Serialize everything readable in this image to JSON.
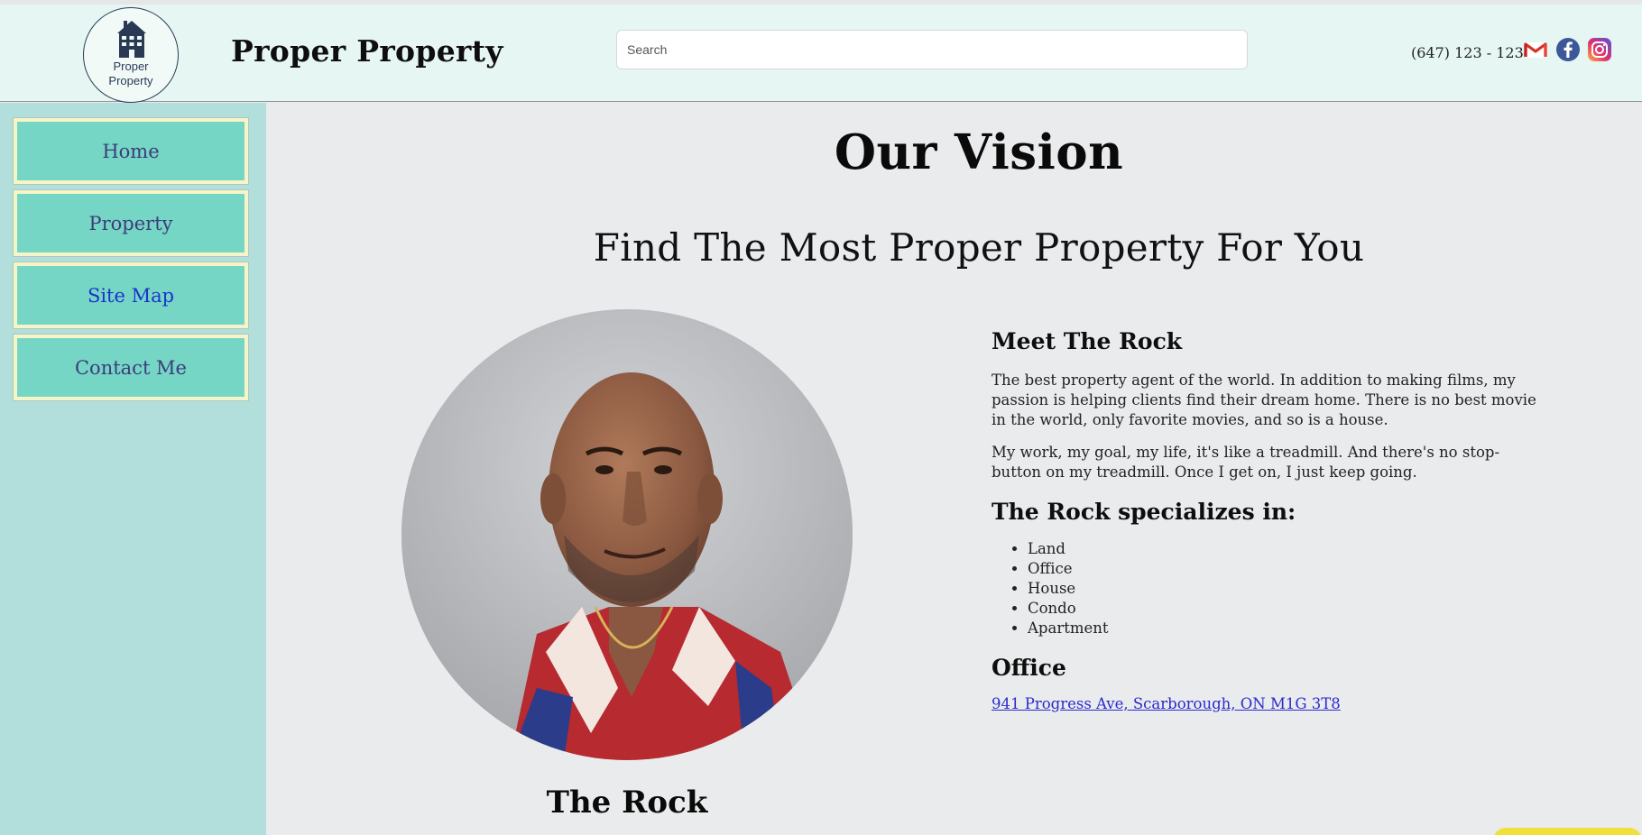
{
  "header": {
    "logo_line1": "Proper",
    "logo_line2": "Property",
    "brand": "Proper Property",
    "search_placeholder": "Search",
    "phone": "(647) 123 - 1234",
    "social": [
      {
        "name": "gmail-icon",
        "color": "#d93025"
      },
      {
        "name": "facebook-icon",
        "color": "#3b5998"
      },
      {
        "name": "instagram-icon",
        "color": "#c13584"
      }
    ]
  },
  "sidebar": {
    "items": [
      {
        "label": "Home",
        "active": false
      },
      {
        "label": "Property",
        "active": false
      },
      {
        "label": "Site Map",
        "active": true
      },
      {
        "label": "Contact Me",
        "active": false
      }
    ]
  },
  "main": {
    "title": "Our Vision",
    "tagline": "Find The Most Proper Property For You",
    "portrait_caption": "The Rock",
    "meet_heading": "Meet The Rock",
    "para1": "The best property agent of the world. In addition to making films, my passion is helping clients find their dream home. There is no best movie in the world, only favorite movies, and so is a house.",
    "para2": "My work, my goal, my life, it's like a treadmill. And there's no stop-button on my treadmill. Once I get on, I just keep going.",
    "specializes_heading": "The Rock specializes in:",
    "specialties": [
      "Land",
      "Office",
      "House",
      "Condo",
      "Apartment"
    ],
    "office_heading": "Office",
    "office_address": "941 Progress Ave, Scarborough, ON M1G 3T8"
  },
  "colors": {
    "header_bg": "#e6f6f3",
    "sidebar_bg": "#b2dfdb",
    "nav_button_bg": "#76d6c5",
    "nav_button_border": "#f7f4c8",
    "link": "#2a2acc",
    "page_bg": "#eaebed"
  }
}
